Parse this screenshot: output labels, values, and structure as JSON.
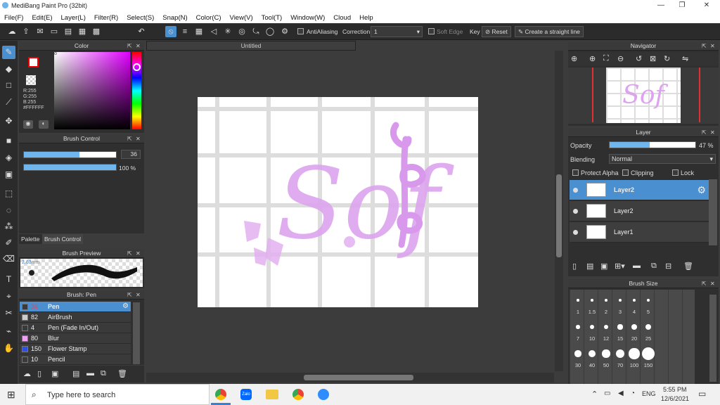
{
  "window": {
    "title": "MediBang Paint Pro (32bit)",
    "min": "—",
    "max": "❐",
    "close": "✕"
  },
  "menu": [
    "File(F)",
    "Edit(E)",
    "Layer(L)",
    "Filter(R)",
    "Select(S)",
    "Snap(N)",
    "Color(C)",
    "View(V)",
    "Tool(T)",
    "Window(W)",
    "Cloud",
    "Help"
  ],
  "toolbar": {
    "antialiasing": "AntiAliasing",
    "correction_label": "Correction",
    "correction_value": "1",
    "soft_edge": "Soft Edge",
    "key": "Key",
    "reset": "Reset",
    "straight_line": "Create a straight line"
  },
  "color_panel": {
    "title": "Color",
    "r": "R:255",
    "g": "G:255",
    "b": "B:255",
    "hex": "#FFFFFF",
    "main_color": "#ff0000"
  },
  "brush_control": {
    "title": "Brush Control",
    "size": "36",
    "size_fill": 0.6,
    "opacity": "100 %",
    "opacity_fill": 1.0
  },
  "tabs": {
    "palette": "Palette",
    "brush_control": "Brush Control"
  },
  "brush_preview": {
    "title": "Brush Preview",
    "size": "2.63mm"
  },
  "brush_list": {
    "title": "Brush: Pen",
    "items": [
      {
        "size": "36",
        "name": "Pen",
        "color": "#3a3a3a",
        "selected": true
      },
      {
        "size": "82",
        "name": "AirBrush",
        "color": "#cccccc",
        "selected": false
      },
      {
        "size": "4",
        "name": "Pen (Fade In/Out)",
        "color": "#3a3a3a",
        "selected": false
      },
      {
        "size": "80",
        "name": "Blur",
        "color": "#f0a0f0",
        "selected": false
      },
      {
        "size": "150",
        "name": "Flower Stamp",
        "color": "#3050e0",
        "selected": false
      },
      {
        "size": "10",
        "name": "Pencil",
        "color": "#3a3a3a",
        "selected": false
      }
    ]
  },
  "canvas": {
    "tab": "Untitled",
    "drawing_text": "Sof"
  },
  "navigator": {
    "title": "Navigator"
  },
  "layer_panel": {
    "title": "Layer",
    "opacity_label": "Opacity",
    "opacity_value": "47 %",
    "opacity_fill": 0.47,
    "blending_label": "Blending",
    "blending_value": "Normal",
    "protect_alpha": "Protect Alpha",
    "clipping": "Clipping",
    "lock": "Lock",
    "layers": [
      {
        "name": "Layer2",
        "selected": true
      },
      {
        "name": "Layer2",
        "selected": false
      },
      {
        "name": "Layer1",
        "selected": false
      }
    ]
  },
  "brush_size": {
    "title": "Brush Size",
    "sizes": [
      "1",
      "1.5",
      "2",
      "3",
      "4",
      "5",
      "7",
      "10",
      "12",
      "15",
      "20",
      "25",
      "30",
      "40",
      "50",
      "70",
      "100",
      "150"
    ]
  },
  "taskbar": {
    "search_placeholder": "Type here to search",
    "lang": "ENG",
    "time": "5:55 PM",
    "date": "12/6/2021"
  }
}
